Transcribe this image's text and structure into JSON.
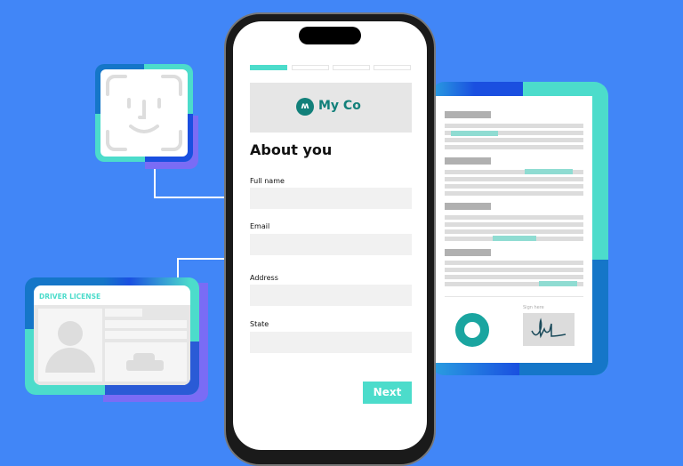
{
  "colors": {
    "background": "#4186f7",
    "teal": "#4cdccb",
    "accent_button": "#4cdccb",
    "brand": "#12807a"
  },
  "form": {
    "progress": {
      "steps": 4,
      "current": 1
    },
    "brand_name": "My Co",
    "title": "About you",
    "fields": [
      {
        "label": "Full name",
        "value": ""
      },
      {
        "label": "Email",
        "value": ""
      },
      {
        "label": "Address",
        "value": ""
      },
      {
        "label": "State",
        "value": ""
      }
    ],
    "next_label": "Next"
  },
  "id_card": {
    "title": "DRIVER LICENSE",
    "icons": [
      "person-icon",
      "car-icon"
    ]
  },
  "face_id": {
    "icon": "face-id-icon"
  },
  "document": {
    "sign_label": "Sign here",
    "icons": [
      "ring-logo-icon",
      "signature-icon"
    ]
  }
}
